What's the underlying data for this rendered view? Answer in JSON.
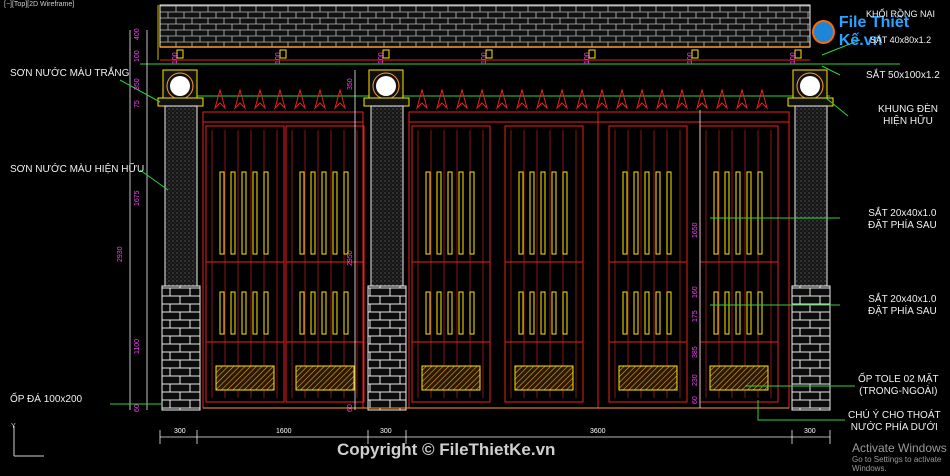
{
  "viewport_label": "[−][Top][2D Wireframe]",
  "watermark": {
    "logo_text": "File Thiết Kế.vn",
    "copyright": "Copyright © FileThietKe.vn"
  },
  "windows_notice": {
    "title": "Activate Windows",
    "subtitle": "Go to Settings to activate Windows."
  },
  "annotations": {
    "left": [
      {
        "id": "paint-white",
        "text": "SƠN NƯỚC MÀU TRẮNG"
      },
      {
        "id": "paint-existing",
        "text": "SƠN NƯỚC MÀU HIỆN HỮU"
      },
      {
        "id": "stone-cladding",
        "text": "ỐP ĐÁ 100x200"
      }
    ],
    "right": [
      {
        "id": "top-note-1",
        "line1": "KHỐI RỒNG NẠI",
        "line2": "SẮT 40x80x1.2"
      },
      {
        "id": "steel-50",
        "line1": "SẮT 50x100x1.2",
        "line2": ""
      },
      {
        "id": "lamp-frame",
        "line1": "KHUNG ĐÈN",
        "line2": "HIỆN HỮU"
      },
      {
        "id": "steel-20-a",
        "line1": "SẮT 20x40x1.0",
        "line2": "ĐẶT PHÍA SAU"
      },
      {
        "id": "steel-20-b",
        "line1": "SẮT 20x40x1.0",
        "line2": "ĐẶT PHÍA SAU"
      },
      {
        "id": "tole",
        "line1": "ỐP TOLE 02 MẶT",
        "line2": "(TRONG-NGOÀI)"
      },
      {
        "id": "drain-note",
        "line1": "CHÚ Ý CHO THOÁT",
        "line2": "NƯỚC PHÍA DƯỚI"
      }
    ]
  },
  "dimensions": {
    "horizontal": [
      "300",
      "1600",
      "300",
      "3600",
      "300"
    ],
    "vertical_left": [
      "400",
      "100",
      "350",
      "75",
      "1675",
      "2930",
      "1100",
      "60"
    ],
    "vertical_mid": [
      "350",
      "2950",
      "60"
    ],
    "vertical_right": [
      "1650",
      "160",
      "175",
      "385",
      "230",
      "60"
    ],
    "top_small": [
      "100",
      "100",
      "100",
      "100",
      "100",
      "100",
      "100"
    ]
  },
  "colors": {
    "background": "#000000",
    "red": "#e82020",
    "yellow": "#ffe600",
    "white": "#f0f0f0",
    "magenta": "#ff3bff",
    "green": "#2fd23a",
    "orange": "#ff9a2e",
    "gray": "#8a8a8a"
  }
}
